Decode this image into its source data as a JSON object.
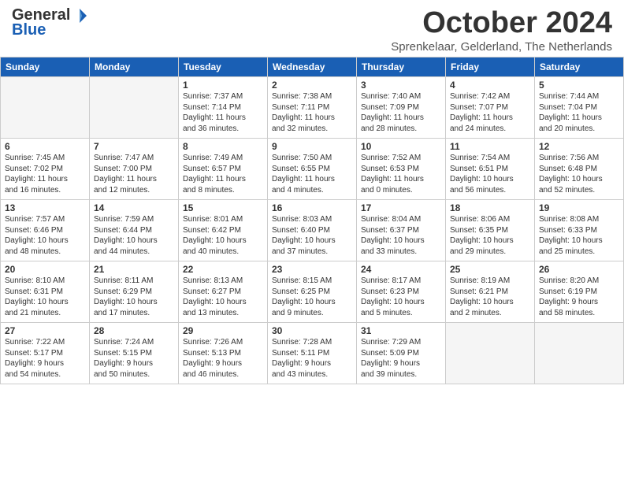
{
  "header": {
    "logo_general": "General",
    "logo_blue": "Blue",
    "month_year": "October 2024",
    "location": "Sprenkelaar, Gelderland, The Netherlands"
  },
  "calendar": {
    "headers": [
      "Sunday",
      "Monday",
      "Tuesday",
      "Wednesday",
      "Thursday",
      "Friday",
      "Saturday"
    ],
    "weeks": [
      [
        {
          "day": "",
          "content": ""
        },
        {
          "day": "",
          "content": ""
        },
        {
          "day": "1",
          "content": "Sunrise: 7:37 AM\nSunset: 7:14 PM\nDaylight: 11 hours\nand 36 minutes."
        },
        {
          "day": "2",
          "content": "Sunrise: 7:38 AM\nSunset: 7:11 PM\nDaylight: 11 hours\nand 32 minutes."
        },
        {
          "day": "3",
          "content": "Sunrise: 7:40 AM\nSunset: 7:09 PM\nDaylight: 11 hours\nand 28 minutes."
        },
        {
          "day": "4",
          "content": "Sunrise: 7:42 AM\nSunset: 7:07 PM\nDaylight: 11 hours\nand 24 minutes."
        },
        {
          "day": "5",
          "content": "Sunrise: 7:44 AM\nSunset: 7:04 PM\nDaylight: 11 hours\nand 20 minutes."
        }
      ],
      [
        {
          "day": "6",
          "content": "Sunrise: 7:45 AM\nSunset: 7:02 PM\nDaylight: 11 hours\nand 16 minutes."
        },
        {
          "day": "7",
          "content": "Sunrise: 7:47 AM\nSunset: 7:00 PM\nDaylight: 11 hours\nand 12 minutes."
        },
        {
          "day": "8",
          "content": "Sunrise: 7:49 AM\nSunset: 6:57 PM\nDaylight: 11 hours\nand 8 minutes."
        },
        {
          "day": "9",
          "content": "Sunrise: 7:50 AM\nSunset: 6:55 PM\nDaylight: 11 hours\nand 4 minutes."
        },
        {
          "day": "10",
          "content": "Sunrise: 7:52 AM\nSunset: 6:53 PM\nDaylight: 11 hours\nand 0 minutes."
        },
        {
          "day": "11",
          "content": "Sunrise: 7:54 AM\nSunset: 6:51 PM\nDaylight: 10 hours\nand 56 minutes."
        },
        {
          "day": "12",
          "content": "Sunrise: 7:56 AM\nSunset: 6:48 PM\nDaylight: 10 hours\nand 52 minutes."
        }
      ],
      [
        {
          "day": "13",
          "content": "Sunrise: 7:57 AM\nSunset: 6:46 PM\nDaylight: 10 hours\nand 48 minutes."
        },
        {
          "day": "14",
          "content": "Sunrise: 7:59 AM\nSunset: 6:44 PM\nDaylight: 10 hours\nand 44 minutes."
        },
        {
          "day": "15",
          "content": "Sunrise: 8:01 AM\nSunset: 6:42 PM\nDaylight: 10 hours\nand 40 minutes."
        },
        {
          "day": "16",
          "content": "Sunrise: 8:03 AM\nSunset: 6:40 PM\nDaylight: 10 hours\nand 37 minutes."
        },
        {
          "day": "17",
          "content": "Sunrise: 8:04 AM\nSunset: 6:37 PM\nDaylight: 10 hours\nand 33 minutes."
        },
        {
          "day": "18",
          "content": "Sunrise: 8:06 AM\nSunset: 6:35 PM\nDaylight: 10 hours\nand 29 minutes."
        },
        {
          "day": "19",
          "content": "Sunrise: 8:08 AM\nSunset: 6:33 PM\nDaylight: 10 hours\nand 25 minutes."
        }
      ],
      [
        {
          "day": "20",
          "content": "Sunrise: 8:10 AM\nSunset: 6:31 PM\nDaylight: 10 hours\nand 21 minutes."
        },
        {
          "day": "21",
          "content": "Sunrise: 8:11 AM\nSunset: 6:29 PM\nDaylight: 10 hours\nand 17 minutes."
        },
        {
          "day": "22",
          "content": "Sunrise: 8:13 AM\nSunset: 6:27 PM\nDaylight: 10 hours\nand 13 minutes."
        },
        {
          "day": "23",
          "content": "Sunrise: 8:15 AM\nSunset: 6:25 PM\nDaylight: 10 hours\nand 9 minutes."
        },
        {
          "day": "24",
          "content": "Sunrise: 8:17 AM\nSunset: 6:23 PM\nDaylight: 10 hours\nand 5 minutes."
        },
        {
          "day": "25",
          "content": "Sunrise: 8:19 AM\nSunset: 6:21 PM\nDaylight: 10 hours\nand 2 minutes."
        },
        {
          "day": "26",
          "content": "Sunrise: 8:20 AM\nSunset: 6:19 PM\nDaylight: 9 hours\nand 58 minutes."
        }
      ],
      [
        {
          "day": "27",
          "content": "Sunrise: 7:22 AM\nSunset: 5:17 PM\nDaylight: 9 hours\nand 54 minutes."
        },
        {
          "day": "28",
          "content": "Sunrise: 7:24 AM\nSunset: 5:15 PM\nDaylight: 9 hours\nand 50 minutes."
        },
        {
          "day": "29",
          "content": "Sunrise: 7:26 AM\nSunset: 5:13 PM\nDaylight: 9 hours\nand 46 minutes."
        },
        {
          "day": "30",
          "content": "Sunrise: 7:28 AM\nSunset: 5:11 PM\nDaylight: 9 hours\nand 43 minutes."
        },
        {
          "day": "31",
          "content": "Sunrise: 7:29 AM\nSunset: 5:09 PM\nDaylight: 9 hours\nand 39 minutes."
        },
        {
          "day": "",
          "content": ""
        },
        {
          "day": "",
          "content": ""
        }
      ]
    ]
  }
}
